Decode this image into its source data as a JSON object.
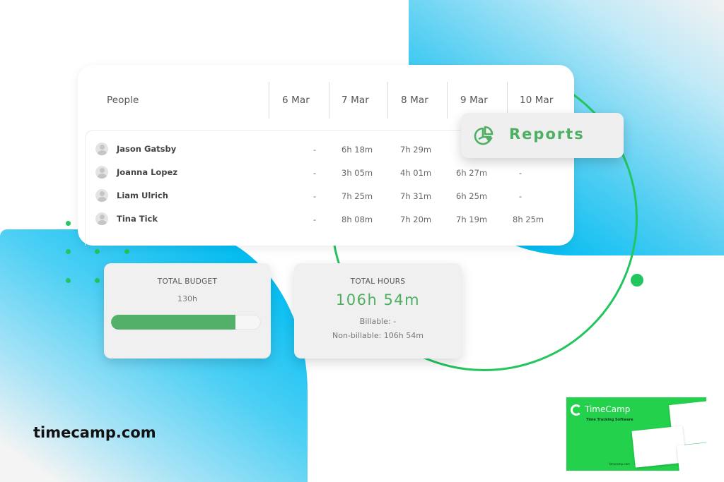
{
  "table": {
    "header": {
      "people_label": "People",
      "dates": [
        "6 Mar",
        "7 Mar",
        "8 Mar",
        "9 Mar",
        "10 Mar"
      ]
    },
    "rows": [
      {
        "name": "Jason Gatsby",
        "values": [
          "-",
          "6h 18m",
          "7h 29m",
          "-",
          ""
        ]
      },
      {
        "name": "Joanna Lopez",
        "values": [
          "-",
          "3h 05m",
          "4h 01m",
          "6h 27m",
          "-"
        ]
      },
      {
        "name": "Liam Ulrich",
        "values": [
          "-",
          "7h 25m",
          "7h 31m",
          "6h 25m",
          "-"
        ]
      },
      {
        "name": "Tina Tick",
        "values": [
          "-",
          "8h 08m",
          "7h 20m",
          "7h 19m",
          "8h 25m"
        ]
      }
    ]
  },
  "reports": {
    "label": "Reports",
    "icon": "pie-chart-icon"
  },
  "budget": {
    "title": "TOTAL BUDGET",
    "value": "130h",
    "progress_percent": 83
  },
  "hours": {
    "title": "TOTAL HOURS",
    "total": "106h 54m",
    "billable": "Billable: -",
    "non_billable": "Non-billable: 106h 54m"
  },
  "footer": {
    "site": "timecamp.com"
  },
  "thumbnail": {
    "brand": "TimeCamp",
    "subtitle": "Time Tracking Software",
    "url": "timecamp.com"
  },
  "colors": {
    "accent_green": "#4caf62",
    "ring_green": "#22c55e",
    "blue": "#04bdf1"
  }
}
